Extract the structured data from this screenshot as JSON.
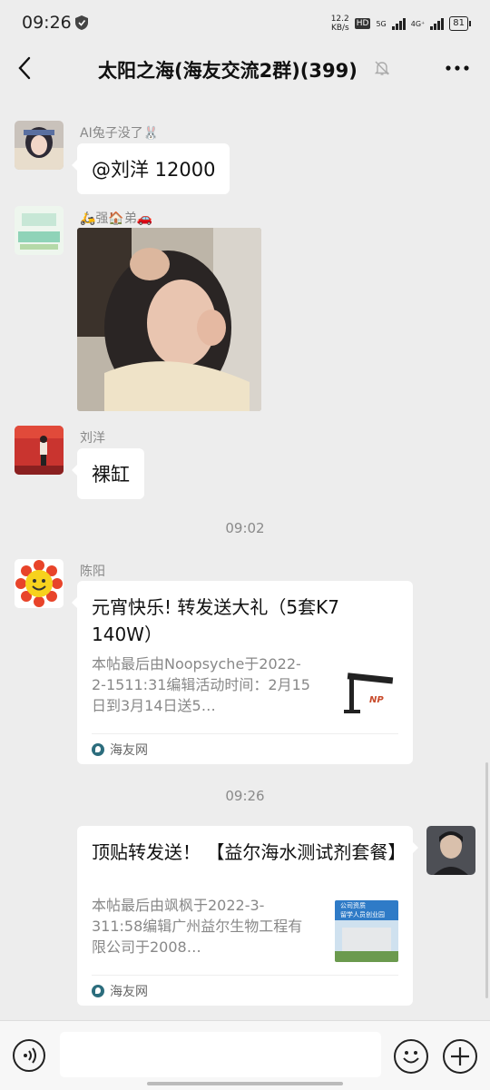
{
  "status_bar": {
    "time": "09:26",
    "speed_value": "12.2",
    "speed_unit": "KB/s",
    "hd_label": "HD",
    "net_1": "5G",
    "net_2": "4G⁺",
    "battery": "81"
  },
  "nav": {
    "title": "太阳之海(海友交流2群)(399)",
    "back_icon": "chevron-left-icon",
    "mute_icon": "bell-off-icon",
    "more_icon": "more-dots-icon"
  },
  "messages": [
    {
      "sender": "AI兔子没了🐰",
      "text": "@刘洋  12000"
    },
    {
      "sender": "🛵强🏠弟🚗",
      "type": "photo"
    },
    {
      "sender": "刘洋",
      "text": "裸缸"
    }
  ],
  "timestamps": [
    "09:02",
    "09:26"
  ],
  "cards": [
    {
      "sender": "陈阳",
      "title": "元宵快乐! 转发送大礼（5套K7 140W）",
      "description": "本帖最后由Noopsyche于2022-2-1511:31编辑活动时间：2月15日到3月14日送5…",
      "thumb_text": "NP",
      "source": "海友网"
    },
    {
      "title": "顶贴转发送！ 【益尔海水测试剂套餐】",
      "description": "本帖最后由飒枫于2022-3-311:58编辑广州益尔生物工程有限公司于2008…",
      "thumb_text_1": "公司资质",
      "thumb_text_2": "留学人员创业园",
      "source": "海友网"
    }
  ],
  "input": {
    "placeholder": "",
    "value": ""
  },
  "colors": {
    "background": "#ededed",
    "bubble": "#ffffff",
    "meta_text": "#888888"
  }
}
